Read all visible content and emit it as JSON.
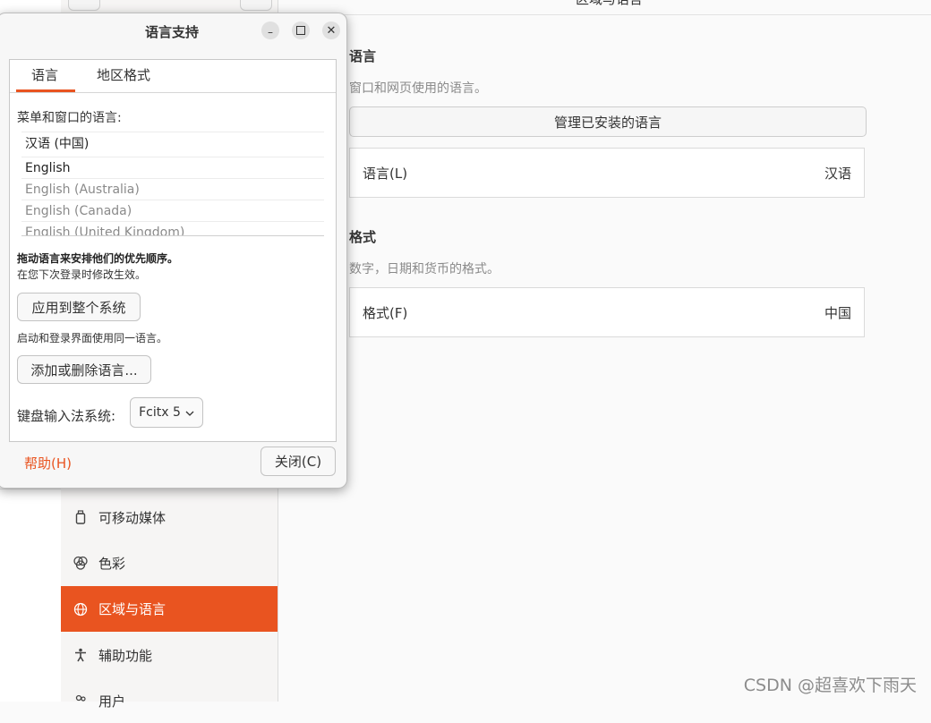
{
  "settings": {
    "window_title": "区域与语言",
    "sidebar": [
      {
        "label": "可移动媒体",
        "icon": "usb-drive-icon"
      },
      {
        "label": "色彩",
        "icon": "color-icon"
      },
      {
        "label": "区域与语言",
        "icon": "globe-icon",
        "active": true
      },
      {
        "label": "辅助功能",
        "icon": "accessibility-icon"
      },
      {
        "label": "用户",
        "icon": "users-icon"
      }
    ],
    "language_section": {
      "title": "语言",
      "description": "窗口和网页使用的语言。",
      "manage_button": "管理已安装的语言",
      "row_label": "语言(L)",
      "row_value": "汉语"
    },
    "format_section": {
      "title": "格式",
      "description": "数字，日期和货币的格式。",
      "row_label": "格式(F)",
      "row_value": "中国"
    }
  },
  "dialog": {
    "title": "语言支持",
    "tabs": [
      "语言",
      "地区格式"
    ],
    "menu_lang_label": "菜单和窗口的语言:",
    "languages": [
      {
        "name": "汉语 (中国)",
        "enabled": true
      },
      {
        "name": "English",
        "enabled": true
      },
      {
        "name": "English (Australia)",
        "enabled": false
      },
      {
        "name": "English (Canada)",
        "enabled": false
      },
      {
        "name": "English (United Kingdom)",
        "enabled": false
      }
    ],
    "drag_hint": "拖动语言来安排他们的优先顺序。",
    "effect_hint": "在您下次登录时修改生效。",
    "apply_button": "应用到整个系统",
    "login_hint": "启动和登录界面使用同一语言。",
    "add_remove_button": "添加或删除语言...",
    "input_method_label": "键盘输入法系统:",
    "input_method_value": "Fcitx 5",
    "help_button": "帮助(H)",
    "close_button": "关闭(C)",
    "colors": {
      "accent": "#e95420",
      "disabled_text": "#8a8a8a"
    }
  },
  "watermark": "CSDN @超喜欢下雨天"
}
